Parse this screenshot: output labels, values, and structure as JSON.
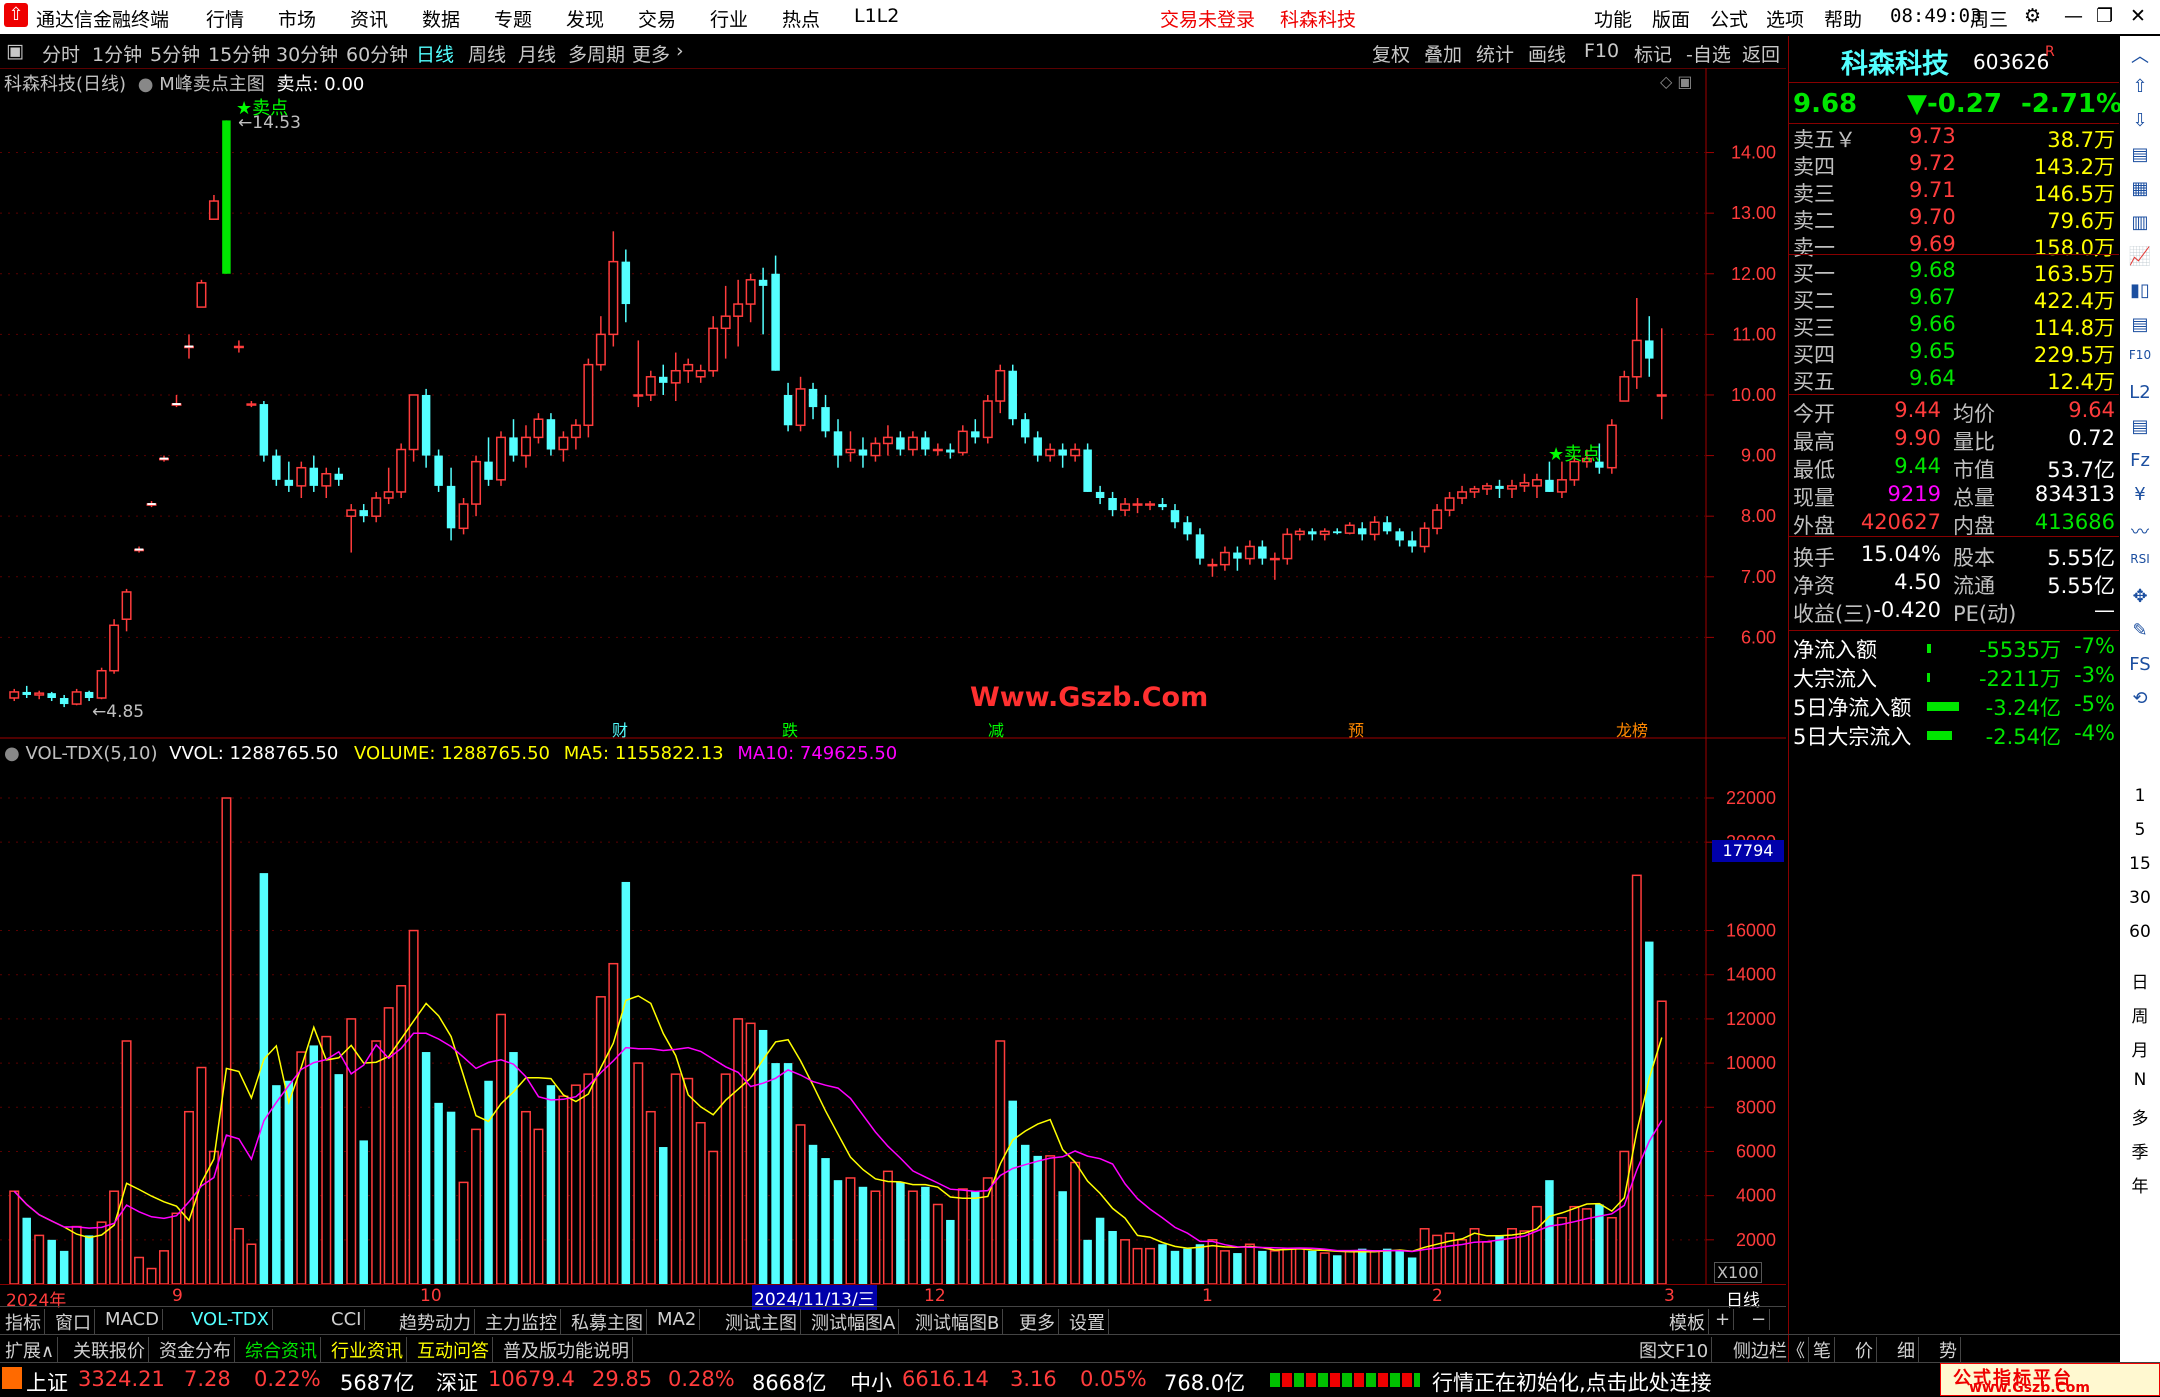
{
  "titlebar": {
    "app_name": "通达信金融终端",
    "menus": [
      "行情",
      "市场",
      "资讯",
      "数据",
      "专题",
      "发现",
      "交易",
      "行业",
      "热点",
      "L1L2"
    ],
    "notice": "交易未登录",
    "stock_name": "科森科技",
    "right_menus": [
      "功能",
      "版面",
      "公式",
      "选项",
      "帮助"
    ],
    "time": "08:49:03",
    "weekday": "周三"
  },
  "toolbar": {
    "periods": [
      "分时",
      "1分钟",
      "5分钟",
      "15分钟",
      "30分钟",
      "60分钟",
      "日线",
      "周线",
      "月线",
      "多周期",
      "更多"
    ],
    "active_period": "日线",
    "actions": [
      "复权",
      "叠加",
      "统计",
      "画线",
      "F10",
      "标记",
      "-自选",
      "返回"
    ]
  },
  "main_panel": {
    "header": "科森科技(日线)",
    "indicator": "M峰卖点主图",
    "sell_label": "卖点: 0.00",
    "high_label": "14.53",
    "low_label": "4.85",
    "sell_marker": "卖点",
    "watermark": "Www.Gszb.Com",
    "event_markers": [
      "财",
      "跌",
      "减",
      "预",
      "龙榜"
    ],
    "y_ticks": [
      "14.00",
      "13.00",
      "12.00",
      "11.00",
      "10.00",
      "9.00",
      "8.00",
      "7.00",
      "6.00"
    ]
  },
  "vol_panel": {
    "header_name": "VOL-TDX(5,10)",
    "vvol": "VVOL: 1288765.50",
    "volume": "VOLUME: 1288765.50",
    "ma5": "MA5: 1155822.13",
    "ma10": "MA10: 749625.50",
    "y_ticks": [
      "22000",
      "20000",
      "16000",
      "14000",
      "12000",
      "10000",
      "8000",
      "6000",
      "4000",
      "2000"
    ],
    "cursor_value": "17794",
    "unit": "X100"
  },
  "x_axis": {
    "labels": [
      "2024年",
      "9",
      "10",
      "2024/11/13/三",
      "12",
      "1",
      "2",
      "3"
    ],
    "period": "日线"
  },
  "quote": {
    "name": "科森科技",
    "code": "603626",
    "suffix": "R",
    "price": "9.68",
    "change": "▼-0.27",
    "pct": "-2.71%",
    "asks": [
      {
        "label": "卖五￥",
        "price": "9.73",
        "vol": "38.7万"
      },
      {
        "label": "卖四",
        "price": "9.72",
        "vol": "143.2万"
      },
      {
        "label": "卖三",
        "price": "9.71",
        "vol": "146.5万"
      },
      {
        "label": "卖二",
        "price": "9.70",
        "vol": "79.6万"
      },
      {
        "label": "卖一",
        "price": "9.69",
        "vol": "158.0万"
      }
    ],
    "bids": [
      {
        "label": "买一",
        "price": "9.68",
        "vol": "163.5万"
      },
      {
        "label": "买二",
        "price": "9.67",
        "vol": "422.4万"
      },
      {
        "label": "买三",
        "price": "9.66",
        "vol": "114.8万"
      },
      {
        "label": "买四",
        "price": "9.65",
        "vol": "229.5万"
      },
      {
        "label": "买五",
        "price": "9.64",
        "vol": "12.4万"
      }
    ],
    "stats": [
      {
        "l1": "今开",
        "v1": "9.44",
        "l2": "均价",
        "v2": "9.64"
      },
      {
        "l1": "最高",
        "v1": "9.90",
        "l2": "量比",
        "v2": "0.72"
      },
      {
        "l1": "最低",
        "v1": "9.44",
        "l2": "市值",
        "v2": "53.7亿"
      },
      {
        "l1": "现量",
        "v1": "9219",
        "l2": "总量",
        "v2": "834313"
      },
      {
        "l1": "外盘",
        "v1": "420627",
        "l2": "内盘",
        "v2": "413686"
      }
    ],
    "stats2": [
      {
        "l1": "换手",
        "v1": "15.04%",
        "l2": "股本",
        "v2": "5.55亿"
      },
      {
        "l1": "净资",
        "v1": "4.50",
        "l2": "流通",
        "v2": "5.55亿"
      },
      {
        "l1": "收益(三)",
        "v1": "-0.420",
        "l2": "PE(动)",
        "v2": "—"
      }
    ],
    "flows": [
      {
        "label": "净流入额",
        "value": "-5535万",
        "pct": "-7%",
        "bar": 0.1
      },
      {
        "label": "大宗流入",
        "value": "-2211万",
        "pct": "-3%",
        "bar": 0.05
      },
      {
        "label": "5日净流入额",
        "value": "-3.24亿",
        "pct": "-5%",
        "bar": 0.9
      },
      {
        "label": "5日大宗流入",
        "value": "-2.54亿",
        "pct": "-4%",
        "bar": 0.7
      }
    ]
  },
  "tabs_row1": [
    "指标",
    "窗口",
    "MACD",
    "VOL-TDX",
    "CCI",
    "趋势动力",
    "主力监控",
    "私募主图",
    "MA2",
    "测试主图",
    "测试幅图A",
    "测试幅图B",
    "更多",
    "设置"
  ],
  "tabs_row1_right": [
    "模板",
    "+",
    "−"
  ],
  "tabs_row2": [
    "扩展∧",
    "关联报价",
    "资金分布",
    "综合资讯",
    "行业资讯",
    "互动问答",
    "普及版功能说明"
  ],
  "tabs_row2_right": [
    "图文F10",
    "侧边栏《",
    "笔",
    "价",
    "细",
    "势"
  ],
  "status": {
    "sh_label": "上证",
    "sh_val": "3324.21",
    "sh_chg": "7.28",
    "sh_pct": "0.22%",
    "sh_amt": "5687亿",
    "sz_label": "深证",
    "sz_val": "10679.4",
    "sz_chg": "29.85",
    "sz_pct": "0.28%",
    "sz_amt": "8668亿",
    "zx_label": "中小",
    "zx_val": "6616.14",
    "zx_chg": "3.16",
    "zx_pct": "0.05%",
    "zx_amt": "768.0亿",
    "message": "行情正在初始化,点击此处连接",
    "brand": "公式指标平台",
    "brand_url": "www.Gszb.Com"
  },
  "sidebar_labels": [
    "1",
    "5",
    "15",
    "30",
    "60",
    "日",
    "周",
    "月",
    "N",
    "多",
    "季",
    "年"
  ],
  "colors": {
    "up": "#ff3c3c",
    "down": "#54ffff",
    "yellow": "#ffff00",
    "magenta": "#ff00ff",
    "green": "#00e600"
  },
  "chart_data": {
    "type": "candlestick",
    "price_range": [
      4.5,
      15.0
    ],
    "candles": [
      [
        5.0,
        5.15,
        4.95,
        5.1
      ],
      [
        5.1,
        5.2,
        5.0,
        5.05
      ],
      [
        5.05,
        5.12,
        4.98,
        5.08
      ],
      [
        5.08,
        5.1,
        4.95,
        5.0
      ],
      [
        5.0,
        5.05,
        4.85,
        4.9
      ],
      [
        4.9,
        5.15,
        4.88,
        5.1
      ],
      [
        5.1,
        5.12,
        4.95,
        5.0
      ],
      [
        5.0,
        5.5,
        4.98,
        5.45
      ],
      [
        5.45,
        6.3,
        5.4,
        6.2
      ],
      [
        6.3,
        6.8,
        6.1,
        6.75
      ],
      [
        7.45,
        7.5,
        7.4,
        7.45
      ],
      [
        8.2,
        8.25,
        8.15,
        8.2
      ],
      [
        8.95,
        9.0,
        8.9,
        8.95
      ],
      [
        9.85,
        10.0,
        9.8,
        9.85
      ],
      [
        10.8,
        11.0,
        10.6,
        10.8
      ],
      [
        11.45,
        11.9,
        11.45,
        11.85
      ],
      [
        12.9,
        13.3,
        12.9,
        13.2
      ],
      [
        12.0,
        14.53,
        12.0,
        14.53
      ],
      [
        10.8,
        10.9,
        10.7,
        10.8
      ],
      [
        9.85,
        9.9,
        9.8,
        9.85
      ],
      [
        9.85,
        9.9,
        8.9,
        9.0
      ],
      [
        9.0,
        9.1,
        8.5,
        8.6
      ],
      [
        8.6,
        8.9,
        8.4,
        8.5
      ],
      [
        8.5,
        8.9,
        8.3,
        8.8
      ],
      [
        8.8,
        9.0,
        8.4,
        8.5
      ],
      [
        8.5,
        8.8,
        8.3,
        8.7
      ],
      [
        8.7,
        8.8,
        8.5,
        8.6
      ],
      [
        8.0,
        8.2,
        7.4,
        8.1
      ],
      [
        8.1,
        8.2,
        7.9,
        8.0
      ],
      [
        8.0,
        8.4,
        7.9,
        8.3
      ],
      [
        8.3,
        8.8,
        8.2,
        8.4
      ],
      [
        8.4,
        9.2,
        8.3,
        9.1
      ],
      [
        9.1,
        10.0,
        8.9,
        10.0
      ],
      [
        10.0,
        10.1,
        8.8,
        9.0
      ],
      [
        9.0,
        9.1,
        8.4,
        8.5
      ],
      [
        8.5,
        8.8,
        7.6,
        7.8
      ],
      [
        7.8,
        8.3,
        7.7,
        8.2
      ],
      [
        8.2,
        9.0,
        8.0,
        8.9
      ],
      [
        8.9,
        9.3,
        8.5,
        8.6
      ],
      [
        8.6,
        9.4,
        8.5,
        9.3
      ],
      [
        9.3,
        9.6,
        8.9,
        9.0
      ],
      [
        9.0,
        9.5,
        8.8,
        9.3
      ],
      [
        9.3,
        9.7,
        9.2,
        9.6
      ],
      [
        9.6,
        9.7,
        9.0,
        9.1
      ],
      [
        9.1,
        9.4,
        8.9,
        9.3
      ],
      [
        9.3,
        9.6,
        9.1,
        9.5
      ],
      [
        9.5,
        10.6,
        9.3,
        10.5
      ],
      [
        10.5,
        11.3,
        10.4,
        11.0
      ],
      [
        11.0,
        12.7,
        10.8,
        12.2
      ],
      [
        12.2,
        12.4,
        11.2,
        11.5
      ],
      [
        10.0,
        10.9,
        9.8,
        10.0
      ],
      [
        10.0,
        10.4,
        9.9,
        10.3
      ],
      [
        10.3,
        10.5,
        10.0,
        10.2
      ],
      [
        10.2,
        10.7,
        9.9,
        10.4
      ],
      [
        10.4,
        10.6,
        10.2,
        10.5
      ],
      [
        10.3,
        10.5,
        10.2,
        10.4
      ],
      [
        10.4,
        11.3,
        10.3,
        11.1
      ],
      [
        11.1,
        11.8,
        10.6,
        11.3
      ],
      [
        11.3,
        11.9,
        10.8,
        11.5
      ],
      [
        11.5,
        12.0,
        11.2,
        11.9
      ],
      [
        11.9,
        12.1,
        11.0,
        11.8
      ],
      [
        12.0,
        12.3,
        10.4,
        10.4
      ],
      [
        10.0,
        10.2,
        9.4,
        9.5
      ],
      [
        9.5,
        10.3,
        9.4,
        10.1
      ],
      [
        10.1,
        10.2,
        9.6,
        9.8
      ],
      [
        9.8,
        10.0,
        9.3,
        9.4
      ],
      [
        9.4,
        9.6,
        8.8,
        9.0
      ],
      [
        9.05,
        9.4,
        8.9,
        9.1
      ],
      [
        9.1,
        9.3,
        8.8,
        9.0
      ],
      [
        9.0,
        9.3,
        8.9,
        9.2
      ],
      [
        9.2,
        9.5,
        9.0,
        9.3
      ],
      [
        9.3,
        9.4,
        9.0,
        9.1
      ],
      [
        9.1,
        9.4,
        9.0,
        9.3
      ],
      [
        9.3,
        9.4,
        9.0,
        9.1
      ],
      [
        9.1,
        9.2,
        9.0,
        9.1
      ],
      [
        9.1,
        9.2,
        8.95,
        9.05
      ],
      [
        9.05,
        9.5,
        9.0,
        9.4
      ],
      [
        9.4,
        9.6,
        9.2,
        9.3
      ],
      [
        9.3,
        10.0,
        9.2,
        9.9
      ],
      [
        9.9,
        10.5,
        9.7,
        10.4
      ],
      [
        10.4,
        10.5,
        9.5,
        9.6
      ],
      [
        9.6,
        9.7,
        9.2,
        9.3
      ],
      [
        9.3,
        9.4,
        8.9,
        9.0
      ],
      [
        9.0,
        9.2,
        8.9,
        9.1
      ],
      [
        9.1,
        9.2,
        8.8,
        9.0
      ],
      [
        9.0,
        9.2,
        8.9,
        9.1
      ],
      [
        9.1,
        9.2,
        8.4,
        8.4
      ],
      [
        8.4,
        8.5,
        8.2,
        8.3
      ],
      [
        8.3,
        8.4,
        8.0,
        8.1
      ],
      [
        8.1,
        8.3,
        8.0,
        8.2
      ],
      [
        8.2,
        8.3,
        8.05,
        8.2
      ],
      [
        8.2,
        8.25,
        8.1,
        8.2
      ],
      [
        8.2,
        8.3,
        8.1,
        8.15
      ],
      [
        8.1,
        8.2,
        7.8,
        7.9
      ],
      [
        7.9,
        8.0,
        7.6,
        7.7
      ],
      [
        7.7,
        7.8,
        7.2,
        7.3
      ],
      [
        7.2,
        7.3,
        7.0,
        7.2
      ],
      [
        7.2,
        7.5,
        7.1,
        7.4
      ],
      [
        7.4,
        7.5,
        7.1,
        7.3
      ],
      [
        7.3,
        7.6,
        7.2,
        7.5
      ],
      [
        7.5,
        7.6,
        7.2,
        7.3
      ],
      [
        7.3,
        7.4,
        6.95,
        7.3
      ],
      [
        7.3,
        7.8,
        7.2,
        7.7
      ],
      [
        7.7,
        7.8,
        7.6,
        7.75
      ],
      [
        7.75,
        7.8,
        7.6,
        7.7
      ],
      [
        7.7,
        7.8,
        7.6,
        7.75
      ],
      [
        7.75,
        7.8,
        7.7,
        7.72
      ],
      [
        7.72,
        7.9,
        7.7,
        7.85
      ],
      [
        7.8,
        7.9,
        7.6,
        7.7
      ],
      [
        7.7,
        8.0,
        7.6,
        7.9
      ],
      [
        7.9,
        8.0,
        7.7,
        7.75
      ],
      [
        7.75,
        7.8,
        7.5,
        7.6
      ],
      [
        7.6,
        7.75,
        7.4,
        7.5
      ],
      [
        7.5,
        7.9,
        7.4,
        7.8
      ],
      [
        7.8,
        8.2,
        7.7,
        8.1
      ],
      [
        8.1,
        8.4,
        8.0,
        8.3
      ],
      [
        8.3,
        8.5,
        8.2,
        8.4
      ],
      [
        8.4,
        8.5,
        8.3,
        8.45
      ],
      [
        8.45,
        8.55,
        8.35,
        8.5
      ],
      [
        8.5,
        8.6,
        8.3,
        8.45
      ],
      [
        8.45,
        8.6,
        8.3,
        8.5
      ],
      [
        8.5,
        8.7,
        8.4,
        8.55
      ],
      [
        8.5,
        8.7,
        8.3,
        8.6
      ],
      [
        8.6,
        8.9,
        8.4,
        8.4
      ],
      [
        8.4,
        8.9,
        8.3,
        8.6
      ],
      [
        8.6,
        9.0,
        8.5,
        8.9
      ],
      [
        8.9,
        9.1,
        8.8,
        8.95
      ],
      [
        8.9,
        9.2,
        8.7,
        8.8
      ],
      [
        8.8,
        9.6,
        8.7,
        9.5
      ],
      [
        9.9,
        10.4,
        9.9,
        10.3
      ],
      [
        10.3,
        11.6,
        10.1,
        10.9
      ],
      [
        10.9,
        11.3,
        10.3,
        10.6
      ],
      [
        10.0,
        11.1,
        9.6,
        10.0
      ]
    ],
    "volume": [
      4200,
      3000,
      2200,
      2000,
      1500,
      2600,
      2200,
      2800,
      4200,
      11000,
      1200,
      700,
      1500,
      3200,
      7800,
      9800,
      6000,
      22000,
      2500,
      1800,
      18600,
      9000,
      9200,
      10500,
      10800,
      11200,
      9500,
      12000,
      6500,
      11000,
      12500,
      13500,
      16000,
      10500,
      8200,
      7800,
      4600,
      7000,
      9200,
      12200,
      10500,
      7800,
      7000,
      9000,
      8500,
      9000,
      9500,
      13000,
      14500,
      18200,
      10000,
      7800,
      6200,
      9500,
      9300,
      7300,
      6000,
      9500,
      12000,
      11800,
      11500,
      10000,
      10000,
      7200,
      6300,
      5700,
      4700,
      4800,
      4400,
      4200,
      5100,
      4600,
      4200,
      4400,
      3600,
      2900,
      4300,
      4200,
      4800,
      11000,
      8300,
      6300,
      5800,
      5800,
      4200,
      5500,
      2000,
      3000,
      2400,
      2000,
      1600,
      1600,
      1800,
      1500,
      1600,
      1800,
      2000,
      1500,
      1400,
      1800,
      1500,
      1500,
      1600,
      1600,
      1500,
      1400,
      1300,
      1500,
      1600,
      1500,
      1600,
      1500,
      1200,
      2500,
      2200,
      2300,
      2000,
      2500,
      1900,
      2200,
      2500,
      2400,
      3500,
      4700,
      3000,
      3500,
      3400,
      3600,
      3000,
      6000,
      18500,
      15500,
      12800
    ],
    "ma5": "computed",
    "ma10": "computed"
  }
}
